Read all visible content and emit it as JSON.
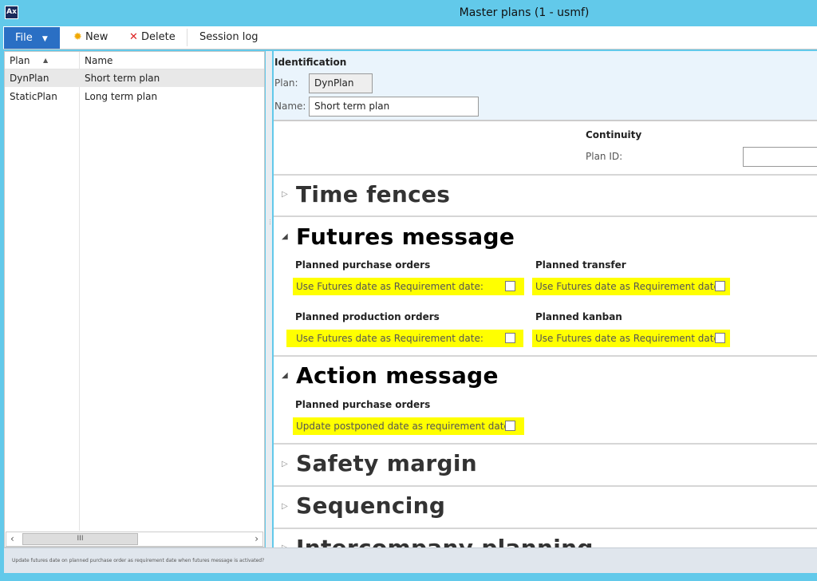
{
  "window": {
    "title": "Master plans (1 - usmf)",
    "icon": "dynamics-ax-icon"
  },
  "toolbar": {
    "file": "File",
    "new": "New",
    "delete": "Delete",
    "session_log": "Session log"
  },
  "grid": {
    "columns": [
      "Plan",
      "Name"
    ],
    "rows": [
      {
        "plan": "DynPlan",
        "name": "Short term plan"
      },
      {
        "plan": "StaticPlan",
        "name": "Long term plan"
      }
    ]
  },
  "identification": {
    "heading": "Identification",
    "plan_label": "Plan:",
    "plan_value": "DynPlan",
    "name_label": "Name:",
    "name_value": "Short term plan"
  },
  "continuity": {
    "heading": "Continuity",
    "plan_id_label": "Plan ID:",
    "plan_id_value": ""
  },
  "sections": {
    "time_fences": "Time fences",
    "futures_message": "Futures message",
    "action_message": "Action message",
    "safety_margin": "Safety margin",
    "sequencing": "Sequencing",
    "intercompany": "Intercompany planning"
  },
  "futures": {
    "ppo": "Planned purchase orders",
    "transfer": "Planned transfer",
    "production": "Planned production orders",
    "kanban": "Planned kanban",
    "option": "Use Futures date as Requirement date:"
  },
  "action": {
    "ppo": "Planned purchase orders",
    "option": "Update postponed date as requirement date:"
  },
  "status": {
    "text": "Update futures date on planned purchase order as requirement date when futures message is activated?"
  },
  "colors": {
    "highlight": "#ffff00",
    "titlebar": "#62c9ea",
    "file_button": "#2a6fc4"
  }
}
